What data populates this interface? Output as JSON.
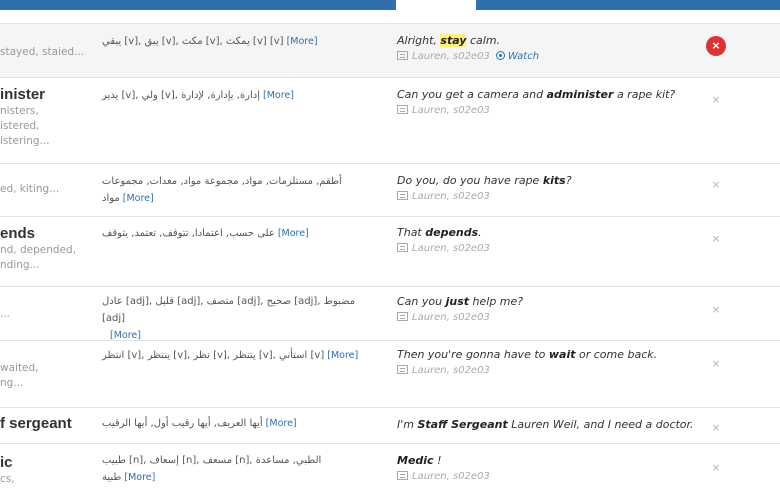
{
  "rows": [
    {
      "word": "",
      "forms": [
        "stayed, staied..."
      ],
      "translation": "يبقي [v], يبق [v], مكث [v], يمكث [v]  [v]",
      "more": "[More]",
      "sentence": [
        "Alright, ",
        "stay",
        " calm."
      ],
      "source": "Lauren, s02e03",
      "watch": "Watch",
      "close": "×"
    },
    {
      "word": "inister",
      "forms": [
        "nisters,",
        "istered,",
        "istering..."
      ],
      "translation": "يدير [v], ولي [v], إدارة, يإدارة, لإدارة",
      "more": "[More]",
      "sentence": [
        "Can you get a camera and ",
        "administer",
        " a rape kit?"
      ],
      "source": "Lauren, s02e03",
      "close": "×"
    },
    {
      "word": "",
      "forms": [
        "ed, kiting..."
      ],
      "translation": "أطقم, مستلزمات, مواد, مجموعة مواد, معدات, مجموعات مواد",
      "more": "[More]",
      "sentence": [
        "Do you, do you have rape ",
        "kits",
        "?"
      ],
      "source": "Lauren, s02e03",
      "close": "×"
    },
    {
      "word": "ends",
      "forms": [
        "nd, depended,",
        "nding..."
      ],
      "translation": "على حسب, اعتمادا, تتوقف, تعتمد, يتوقف",
      "more": "[More]",
      "sentence": [
        "That ",
        "depends",
        "."
      ],
      "source": "Lauren, s02e03",
      "close": "×"
    },
    {
      "word": "",
      "forms": [
        "..."
      ],
      "translation": "عادل [adj], قليل [adj], متصف [adj], صحيح [adj], مضبوط [adj]",
      "more": "[More]",
      "sentence": [
        "Can you ",
        "just",
        " help me?"
      ],
      "source": "Lauren, s02e03",
      "close": "×"
    },
    {
      "word": "",
      "forms": [
        "waited,",
        "ng..."
      ],
      "translation": "انتظر [v], ينتظر [v], نظر [v], يتنظر [v], استأني [v]",
      "more": "[More]",
      "sentence": [
        "Then you're gonna have to ",
        "wait",
        " or come back."
      ],
      "source": "Lauren, s02e03",
      "close": "×"
    },
    {
      "word": "f sergeant",
      "forms": [],
      "translation": "أيها العريف, أيها رقيب أول, أيها الرقيب",
      "more": "[More]",
      "sentence": [
        "I'm ",
        "Staff Sergeant",
        " Lauren Weil, and I need a doctor."
      ],
      "source": "",
      "close": "×"
    },
    {
      "word": "ic",
      "forms": [
        "cs,"
      ],
      "translation": "طبيب [n], إسعاف [n], مسعف [n], الطبي, مساعدة طبية",
      "more": "[More]",
      "sentence": [
        "",
        "Medic",
        " !"
      ],
      "source": "Lauren, s02e03",
      "close": "×"
    }
  ]
}
